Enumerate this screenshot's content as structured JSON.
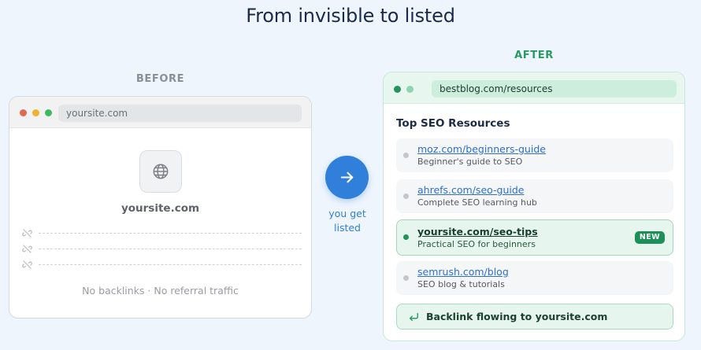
{
  "title": "From invisible to listed",
  "before": {
    "label": "BEFORE",
    "url": "yoursite.com",
    "site_name": "yoursite.com",
    "note": "No backlinks · No referral traffic",
    "icon": "globe-icon"
  },
  "transition": {
    "text_line1": "you get",
    "text_line2": "listed",
    "icon": "arrow-right-icon",
    "color": "#2f7fdb"
  },
  "after": {
    "label": "AFTER",
    "url": "bestblog.com/resources",
    "heading": "Top SEO Resources",
    "resources": [
      {
        "link": "moz.com/beginners-guide",
        "desc": "Beginner's guide to SEO"
      },
      {
        "link": "ahrefs.com/seo-guide",
        "desc": "Complete SEO learning hub"
      },
      {
        "link": "yoursite.com/seo-tips",
        "desc": "Practical SEO for beginners",
        "badge": "NEW"
      },
      {
        "link": "semrush.com/blog",
        "desc": "SEO blog & tutorials"
      }
    ],
    "backlink_text": "Backlink flowing to yoursite.com",
    "accent": "#1f8f58"
  }
}
